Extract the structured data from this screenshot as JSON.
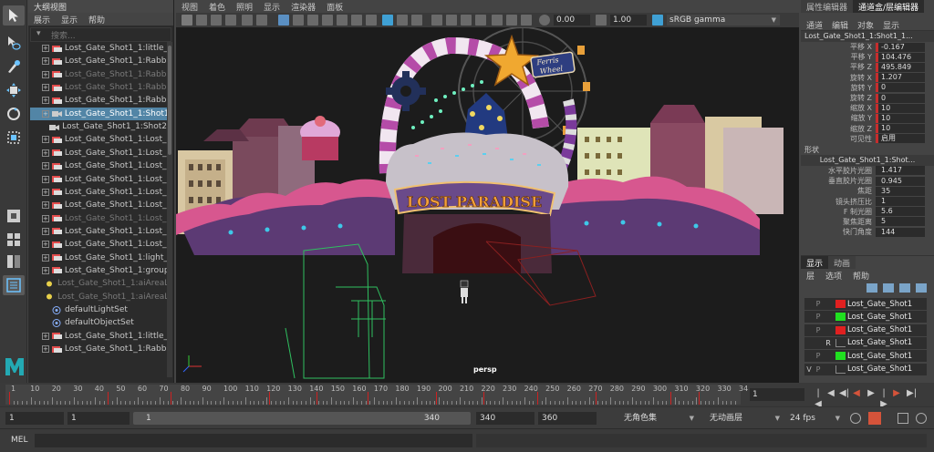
{
  "outliner": {
    "title": "大纲视图",
    "menu": [
      "展示",
      "显示",
      "帮助"
    ],
    "search_placeholder": "搜索...",
    "items": [
      {
        "label": "Lost_Gate_Shot1_1:little_bo",
        "kind": "group",
        "expand": true,
        "state": "normal"
      },
      {
        "label": "Lost_Gate_Shot1_1:Rabbit_l",
        "kind": "group",
        "expand": true,
        "state": "normal"
      },
      {
        "label": "Lost_Gate_Shot1_1:Rabbit_l",
        "kind": "group",
        "expand": true,
        "state": "dim"
      },
      {
        "label": "Lost_Gate_Shot1_1:Rabbit_l",
        "kind": "group",
        "expand": true,
        "state": "dim"
      },
      {
        "label": "Lost_Gate_Shot1_1:Rabbit_l",
        "kind": "group",
        "expand": true,
        "state": "normal"
      },
      {
        "label": "Lost_Gate_Shot1_1:Shot1_1",
        "kind": "camera",
        "expand": true,
        "state": "selected"
      },
      {
        "label": "Lost_Gate_Shot1_1:Shot2",
        "kind": "camera",
        "expand": false,
        "state": "normal"
      },
      {
        "label": "Lost_Gate_Shot1_1:Lost_Ga",
        "kind": "group",
        "expand": true,
        "state": "normal"
      },
      {
        "label": "Lost_Gate_Shot1_1:Lost_Ga",
        "kind": "group",
        "expand": true,
        "state": "normal"
      },
      {
        "label": "Lost_Gate_Shot1_1:Lost_Ga",
        "kind": "group",
        "expand": true,
        "state": "normal"
      },
      {
        "label": "Lost_Gate_Shot1_1:Lost_Ga",
        "kind": "group",
        "expand": true,
        "state": "normal"
      },
      {
        "label": "Lost_Gate_Shot1_1:Lost_Ga",
        "kind": "group",
        "expand": true,
        "state": "normal"
      },
      {
        "label": "Lost_Gate_Shot1_1:Lost_Ga",
        "kind": "group",
        "expand": true,
        "state": "normal"
      },
      {
        "label": "Lost_Gate_Shot1_1:Lost_Ga",
        "kind": "group",
        "expand": true,
        "state": "dim"
      },
      {
        "label": "Lost_Gate_Shot1_1:Lost_Ga",
        "kind": "group",
        "expand": true,
        "state": "normal"
      },
      {
        "label": "Lost_Gate_Shot1_1:Lost_Ga",
        "kind": "group",
        "expand": true,
        "state": "normal"
      },
      {
        "label": "Lost_Gate_Shot1_1:light_ou",
        "kind": "group",
        "expand": true,
        "state": "normal"
      },
      {
        "label": "Lost_Gate_Shot1_1:group",
        "kind": "group",
        "expand": true,
        "state": "normal"
      },
      {
        "label": "Lost_Gate_Shot1_1:aiAreaLi",
        "kind": "light",
        "expand": false,
        "state": "dim"
      },
      {
        "label": "Lost_Gate_Shot1_1:aiAreaLi",
        "kind": "light",
        "expand": false,
        "state": "dim"
      },
      {
        "label": "defaultLightSet",
        "kind": "set",
        "expand": false,
        "state": "normal"
      },
      {
        "label": "defaultObjectSet",
        "kind": "set",
        "expand": false,
        "state": "normal"
      },
      {
        "label": "Lost_Gate_Shot1_1:little_bo",
        "kind": "group",
        "expand": true,
        "state": "normal"
      },
      {
        "label": "Lost_Gate_Shot1_1:Rabbit_l",
        "kind": "group",
        "expand": true,
        "state": "normal"
      }
    ]
  },
  "viewport": {
    "menu": [
      "视图",
      "着色",
      "照明",
      "显示",
      "渲染器",
      "面板"
    ],
    "exposure": "0.00",
    "gamma": "1.00",
    "color_space": "sRGB gamma",
    "camera_label": "persp",
    "sign_text": "LOST PARADISE",
    "ferris_text_1": "Ferris",
    "ferris_text_2": "Wheel"
  },
  "channel_box": {
    "tabs": [
      "属性编辑器",
      "通道盒/层编辑器"
    ],
    "active_tab": 1,
    "menu": [
      "通道",
      "编辑",
      "对象",
      "显示"
    ],
    "object_name": "Lost_Gate_Shot1_1:Shot1_1...",
    "attributes": [
      {
        "label": "平移 X",
        "value": "-0.167",
        "keyed": true
      },
      {
        "label": "平移 Y",
        "value": "104.476",
        "keyed": true
      },
      {
        "label": "平移 Z",
        "value": "495.849",
        "keyed": true
      },
      {
        "label": "旋转 X",
        "value": "1.207",
        "keyed": true
      },
      {
        "label": "旋转 Y",
        "value": "0",
        "keyed": true
      },
      {
        "label": "旋转 Z",
        "value": "0",
        "keyed": true
      },
      {
        "label": "缩放 X",
        "value": "10",
        "keyed": true
      },
      {
        "label": "缩放 Y",
        "value": "10",
        "keyed": true
      },
      {
        "label": "缩放 Z",
        "value": "10",
        "keyed": true
      },
      {
        "label": "可见性",
        "value": "启用",
        "keyed": true
      }
    ],
    "shapes_header": "形状",
    "shape_name": "Lost_Gate_Shot1_1:Shot...",
    "shape_attributes": [
      {
        "label": "水平胶片光圈",
        "value": "1.417"
      },
      {
        "label": "垂直胶片光圈",
        "value": "0.945"
      },
      {
        "label": "焦距",
        "value": "35"
      },
      {
        "label": "镜头挤压比",
        "value": "1"
      },
      {
        "label": "F 制光圈",
        "value": "5.6"
      },
      {
        "label": "聚焦距离",
        "value": "5"
      },
      {
        "label": "快门角度",
        "value": "144"
      }
    ]
  },
  "layer_editor": {
    "tabs": [
      "显示",
      "动画"
    ],
    "menu": [
      "层",
      "选项",
      "帮助"
    ],
    "layers": [
      {
        "v": "",
        "p": "P",
        "r": "",
        "color": "#e02020",
        "name": "Lost_Gate_Shot1"
      },
      {
        "v": "",
        "p": "P",
        "r": "",
        "color": "#20e020",
        "name": "Lost_Gate_Shot1"
      },
      {
        "v": "",
        "p": "P",
        "r": "",
        "color": "#e02020",
        "name": "Lost_Gate_Shot1"
      },
      {
        "v": "",
        "p": "",
        "r": "R",
        "color": "",
        "name": "Lost_Gate_Shot1"
      },
      {
        "v": "",
        "p": "P",
        "r": "",
        "color": "#20e020",
        "name": "Lost_Gate_Shot1"
      },
      {
        "v": "V",
        "p": "P",
        "r": "",
        "color": "",
        "name": "Lost_Gate_Shot1"
      }
    ]
  },
  "timeline": {
    "labels": [
      "1",
      "10",
      "20",
      "30",
      "40",
      "50",
      "60",
      "70",
      "80",
      "90",
      "100",
      "110",
      "120",
      "130",
      "140",
      "150",
      "160",
      "170",
      "180",
      "190",
      "200",
      "210",
      "220",
      "230",
      "240",
      "250",
      "260",
      "270",
      "280",
      "290",
      "300",
      "310",
      "320",
      "330",
      "34"
    ],
    "keys": [
      1,
      47,
      76,
      122,
      144,
      168,
      200,
      222,
      247,
      274,
      309,
      322
    ],
    "current_frame": "1"
  },
  "range": {
    "start": "1",
    "playback_start": "1",
    "slider_start": "1",
    "slider_end": "340",
    "playback_end": "340",
    "end": "360",
    "character_set": "无角色集",
    "anim_layer": "无动画层",
    "fps": "24 fps"
  },
  "command_line": {
    "label": "MEL"
  }
}
